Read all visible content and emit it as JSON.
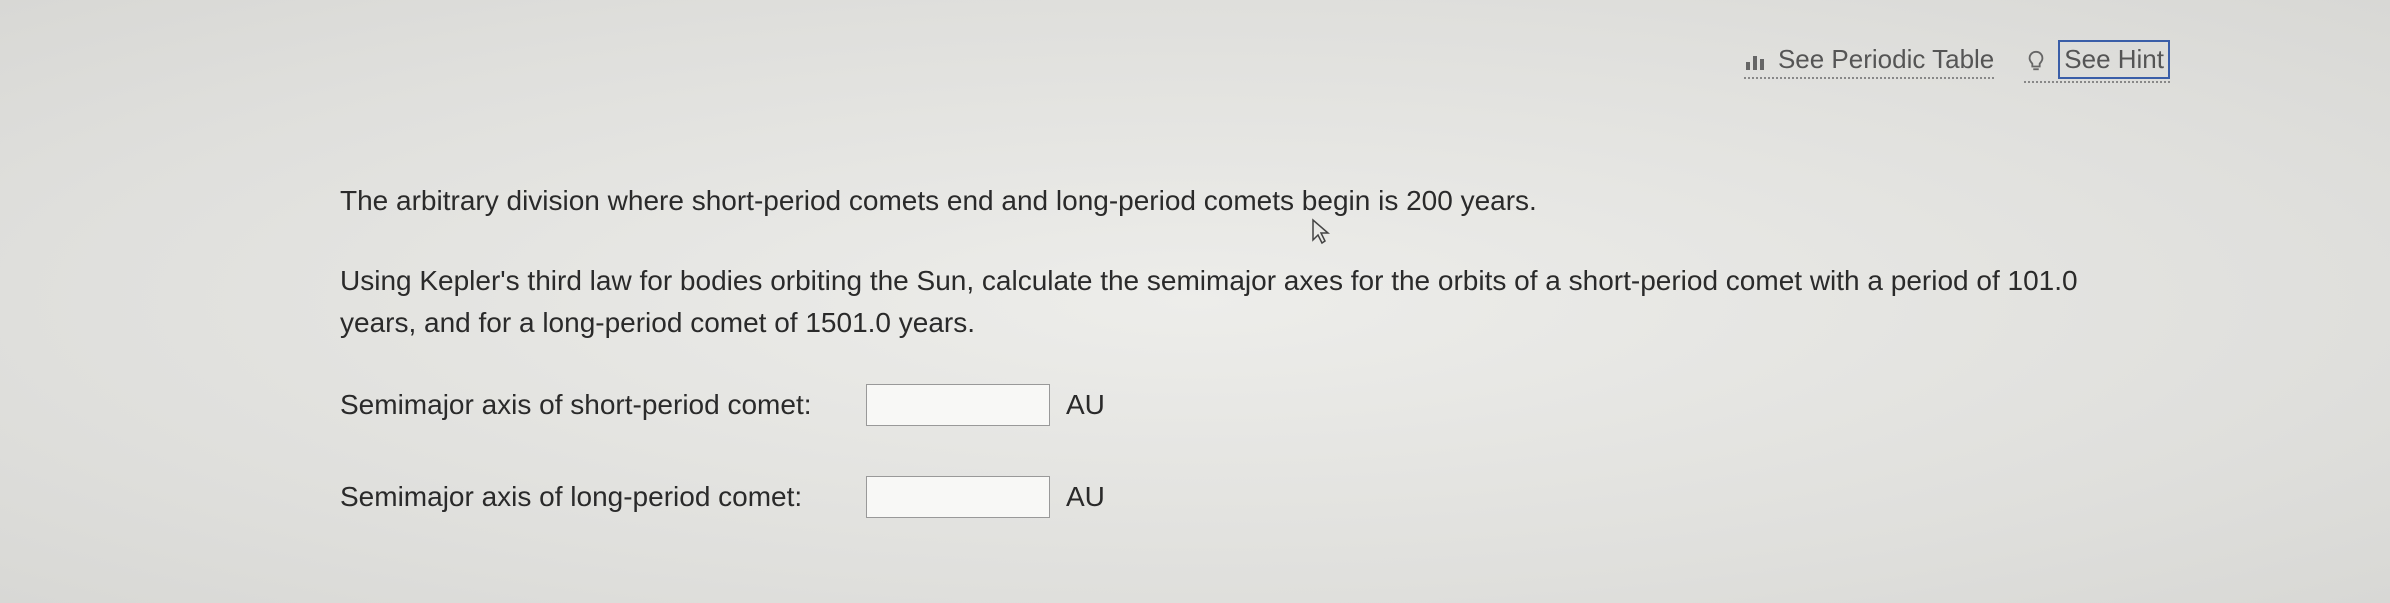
{
  "top_links": {
    "periodic_table": "See Periodic Table",
    "hint": "See Hint"
  },
  "problem": {
    "intro": "The arbitrary division where short-period comets end and long-period comets begin is 200 years.",
    "prompt": "Using Kepler's third law for bodies orbiting the Sun, calculate the semimajor axes for the orbits of a short-period comet with a period of 101.0 years, and for a long-period comet of 1501.0 years."
  },
  "answers": {
    "short": {
      "label": "Semimajor axis of short-period comet:",
      "value": "",
      "unit": "AU"
    },
    "long": {
      "label": "Semimajor axis of long-period comet:",
      "value": "",
      "unit": "AU"
    }
  }
}
